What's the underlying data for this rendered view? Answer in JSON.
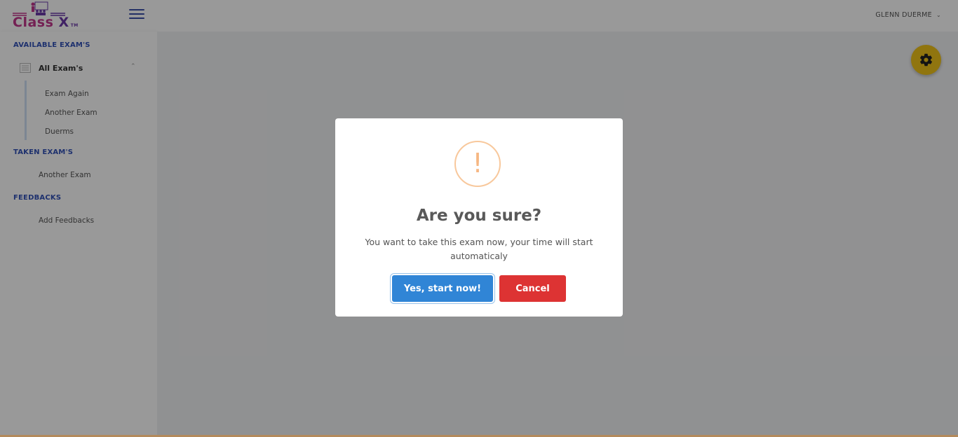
{
  "header": {
    "logo_text": "Class",
    "logo_x": "X",
    "logo_tm": "TM",
    "user_name": "GLENN DUERME"
  },
  "sidebar": {
    "available_title": "AVAILABLE EXAM'S",
    "all_exams_label": "All Exam's",
    "available_items": [
      "Exam Again",
      "Another Exam",
      "Duerms"
    ],
    "taken_title": "TAKEN EXAM'S",
    "taken_items": [
      "Another Exam"
    ],
    "feedback_title": "FEEDBACKS",
    "feedback_items": [
      "Add Feedbacks"
    ]
  },
  "modal": {
    "icon": "!",
    "title": "Are you sure?",
    "text": "You want to take this exam now, your time will start automaticaly",
    "confirm_label": "Yes, start now!",
    "cancel_label": "Cancel"
  },
  "colors": {
    "accent": "#3252b8",
    "confirm": "#3085d6",
    "cancel": "#dd3333",
    "gear": "#f0c419",
    "warning": "#f8bb86"
  }
}
